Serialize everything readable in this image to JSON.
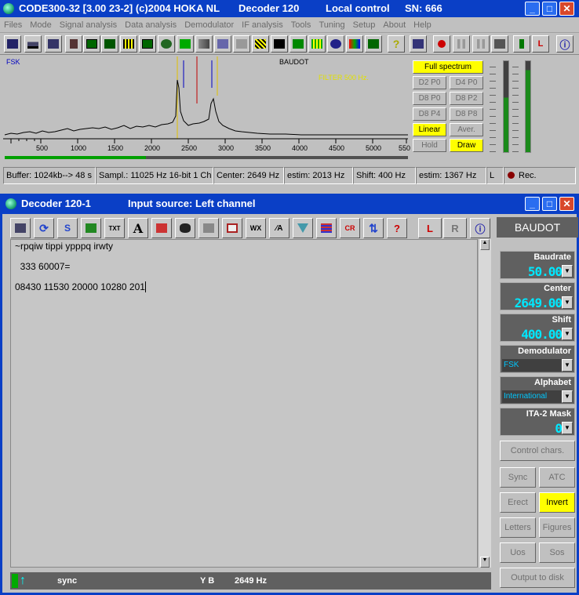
{
  "main_window": {
    "title": "CODE300-32 [3.00 23-2] (c)2004 HOKA NL",
    "decoder": "Decoder 120",
    "control": "Local control",
    "serial": "SN: 666",
    "menu": [
      "Files",
      "Mode",
      "Signal analysis",
      "Data analysis",
      "Demodulator",
      "IF analysis",
      "Tools",
      "Tuning",
      "Setup",
      "About",
      "Help"
    ],
    "spectrum": {
      "mode_label": "FSK",
      "decoder_label": "BAUDOT",
      "filter_label": "FILTER 500 Hz.",
      "freq_ticks": [
        "500",
        "1000",
        "1500",
        "2000",
        "2500",
        "3000",
        "3500",
        "4000",
        "4500",
        "5000",
        "550"
      ]
    },
    "spectrum_buttons": {
      "full": "Full spectrum",
      "d2p0": "D2 P0",
      "d4p0": "D4 P0",
      "d8p0": "D8 P0",
      "d8p2": "D8 P2",
      "d8p4": "D8 P4",
      "d8p8": "D8 P8",
      "linear": "Linear",
      "aver": "Aver.",
      "hold": "Hold",
      "draw": "Draw"
    },
    "status": {
      "buffer": "Buffer: 1024kb--> 48 s",
      "sampl": "Sampl.: 11025 Hz 16-bit 1 Ch",
      "center": "Center: 2649 Hz",
      "estim": "estim: 2013 Hz",
      "shift": "Shift: 400 Hz",
      "estim2": "estim: 1367 Hz",
      "channel": "L",
      "rec": "Rec."
    },
    "lr": {
      "l": "L",
      "r": "R"
    }
  },
  "decoder_window": {
    "title": "Decoder 120-1",
    "input_source": "Input source: Left channel",
    "mode_header": "BAUDOT",
    "text_lines": [
      "~rpqiw tippi ypppq irwty",
      "",
      "  333 60007=",
      "",
      "08430 11530 20000 10280 201"
    ],
    "params": {
      "baudrate": {
        "label": "Baudrate",
        "value": "50.00"
      },
      "center": {
        "label": "Center",
        "value": "2649.00"
      },
      "shift": {
        "label": "Shift",
        "value": "400.00"
      },
      "demodulator": {
        "label": "Demodulator",
        "value": "FSK"
      },
      "alphabet": {
        "label": "Alphabet",
        "value": "International"
      },
      "mask": {
        "label": "ITA-2 Mask",
        "value": "0"
      }
    },
    "buttons": {
      "control": "Control chars.",
      "sync": "Sync",
      "atc": "ATC",
      "erect": "Erect",
      "invert": "Invert",
      "letters": "Letters",
      "figures": "Figures",
      "uos": "Uos",
      "sos": "Sos",
      "output": "Output to disk"
    },
    "status": {
      "sync": "sync",
      "yb": "Y B",
      "freq": "2649 Hz"
    }
  },
  "colors": {
    "titlebar": "#0a3fc6",
    "highlight": "#ffff00",
    "lcd": "#00e8ff"
  }
}
